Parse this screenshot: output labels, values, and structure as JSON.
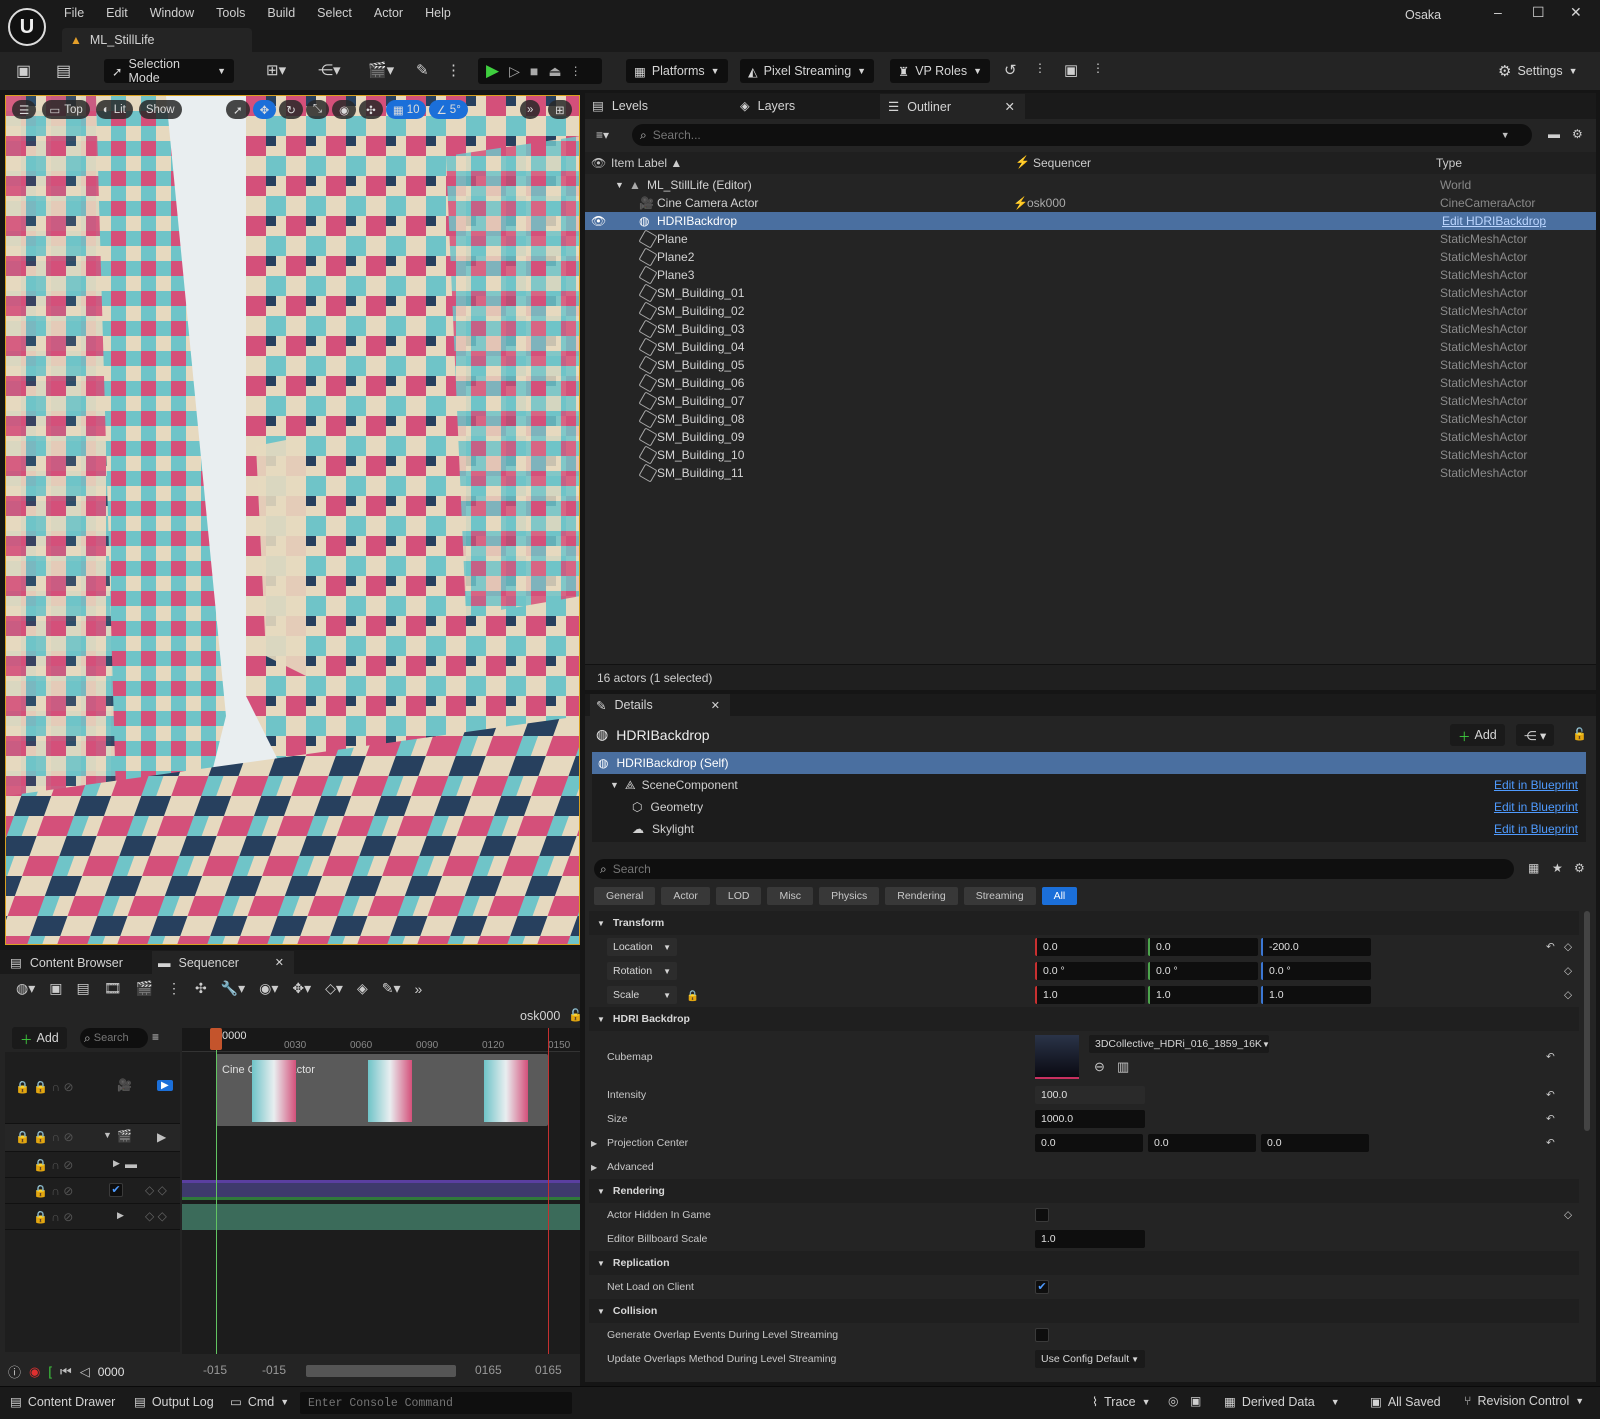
{
  "menu": [
    "File",
    "Edit",
    "Window",
    "Tools",
    "Build",
    "Select",
    "Actor",
    "Help"
  ],
  "project": "Osaka",
  "level_tab": "ML_StillLife",
  "toolbar": {
    "mode": "Selection Mode",
    "platforms": "Platforms",
    "pixel_streaming": "Pixel Streaming",
    "vp_roles": "VP Roles",
    "settings": "Settings"
  },
  "viewport": {
    "view": "Top",
    "lit": "Lit",
    "show": "Show",
    "grid": "10",
    "angle": "5°"
  },
  "viewport_image": {
    "sky": "#e9eef0",
    "teal": "#6fc4c8",
    "pink": "#d4507a",
    "cream": "#e6d9bf",
    "navy": "#27405e"
  },
  "outliner": {
    "tabs": [
      "Levels",
      "Layers",
      "Outliner"
    ],
    "search_placeholder": "Search...",
    "col_label": "Item Label ▲",
    "col_sequencer": "Sequencer",
    "col_type": "Type",
    "world_row": {
      "label": "ML_StillLife (Editor)",
      "type": "World"
    },
    "rows": [
      {
        "label": "Cine Camera Actor",
        "seq": "osk000",
        "type": "CineCameraActor"
      },
      {
        "label": "HDRIBackdrop",
        "seq": "",
        "type": "Edit HDRIBackdrop"
      },
      {
        "label": "Plane",
        "seq": "",
        "type": "StaticMeshActor"
      },
      {
        "label": "Plane2",
        "seq": "",
        "type": "StaticMeshActor"
      },
      {
        "label": "Plane3",
        "seq": "",
        "type": "StaticMeshActor"
      },
      {
        "label": "SM_Building_01",
        "seq": "",
        "type": "StaticMeshActor"
      },
      {
        "label": "SM_Building_02",
        "seq": "",
        "type": "StaticMeshActor"
      },
      {
        "label": "SM_Building_03",
        "seq": "",
        "type": "StaticMeshActor"
      },
      {
        "label": "SM_Building_04",
        "seq": "",
        "type": "StaticMeshActor"
      },
      {
        "label": "SM_Building_05",
        "seq": "",
        "type": "StaticMeshActor"
      },
      {
        "label": "SM_Building_06",
        "seq": "",
        "type": "StaticMeshActor"
      },
      {
        "label": "SM_Building_07",
        "seq": "",
        "type": "StaticMeshActor"
      },
      {
        "label": "SM_Building_08",
        "seq": "",
        "type": "StaticMeshActor"
      },
      {
        "label": "SM_Building_09",
        "seq": "",
        "type": "StaticMeshActor"
      },
      {
        "label": "SM_Building_10",
        "seq": "",
        "type": "StaticMeshActor"
      },
      {
        "label": "SM_Building_11",
        "seq": "",
        "type": "StaticMeshActor"
      }
    ],
    "status": "16 actors (1 selected)"
  },
  "details": {
    "tab": "Details",
    "title": "HDRIBackdrop",
    "add": "Add",
    "components": [
      {
        "label": "HDRIBackdrop (Self)",
        "link": ""
      },
      {
        "label": "SceneComponent",
        "link": "Edit in Blueprint"
      },
      {
        "label": "Geometry",
        "link": "Edit in Blueprint"
      },
      {
        "label": "Skylight",
        "link": "Edit in Blueprint"
      }
    ],
    "search_placeholder": "Search",
    "filters": [
      "General",
      "Actor",
      "LOD",
      "Misc",
      "Physics",
      "Rendering",
      "Streaming",
      "All"
    ],
    "transform": {
      "header": "Transform",
      "location": {
        "label": "Location",
        "x": "0.0",
        "y": "0.0",
        "z": "-200.0"
      },
      "rotation": {
        "label": "Rotation",
        "x": "0.0 °",
        "y": "0.0 °",
        "z": "0.0 °"
      },
      "scale": {
        "label": "Scale",
        "x": "1.0",
        "y": "1.0",
        "z": "1.0"
      }
    },
    "hdri": {
      "header": "HDRI Backdrop",
      "cubemap_label": "Cubemap",
      "cubemap": "3DCollective_HDRi_016_1859_16K",
      "intensity_label": "Intensity",
      "intensity": "100.0",
      "size_label": "Size",
      "size": "1000.0",
      "proj_label": "Projection Center",
      "proj_x": "0.0",
      "proj_y": "0.0",
      "proj_z": "0.0",
      "advanced": "Advanced"
    },
    "rendering": {
      "header": "Rendering",
      "hidden_label": "Actor Hidden In Game",
      "billboard_label": "Editor Billboard Scale",
      "billboard": "1.0"
    },
    "replication": {
      "header": "Replication",
      "net_load": "Net Load on Client"
    },
    "collision": {
      "header": "Collision",
      "overlap_label": "Generate Overlap Events During Level Streaming",
      "update_label": "Update Overlaps Method During Level Streaming",
      "update_value": "Use Config Default"
    }
  },
  "sequencer": {
    "tabs": [
      "Content Browser",
      "Sequencer"
    ],
    "seq_name": "osk000",
    "add": "Add",
    "search_placeholder": "Search",
    "current_frame": "0000",
    "ticks": [
      "0030",
      "0060",
      "0090",
      "0120",
      "0150"
    ],
    "track_label": "Cine Camera Actor",
    "range_start": "-015",
    "range_start2": "-015",
    "range_end": "0165",
    "range_end2": "0165",
    "frame_box": "0000"
  },
  "statusbar": {
    "content_drawer": "Content Drawer",
    "output_log": "Output Log",
    "cmd": "Cmd",
    "console_placeholder": "Enter Console Command",
    "trace": "Trace",
    "derived": "Derived Data",
    "saved": "All Saved",
    "revision": "Revision Control"
  }
}
